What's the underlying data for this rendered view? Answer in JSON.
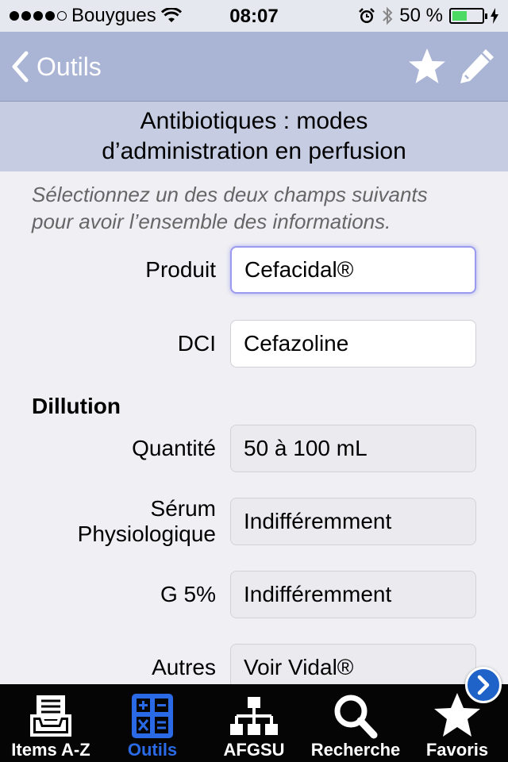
{
  "status_bar": {
    "carrier": "Bouygues",
    "time": "08:07",
    "battery_percent": "50 %",
    "battery_level": 0.5,
    "signal_bars_filled": 4,
    "signal_bars_total": 5
  },
  "nav": {
    "back_label": "Outils",
    "star_icon": "star-icon",
    "edit_icon": "pencil-icon"
  },
  "page": {
    "title": "Antibiotiques : modes\nd’administration en perfusion",
    "instructions": "Sélectionnez un des deux champs suivants\npour avoir l’ensemble des informations."
  },
  "form": {
    "produit_label": "Produit",
    "produit_value": "Cefacidal®",
    "dci_label": "DCI",
    "dci_value": "Cefazoline"
  },
  "dilution": {
    "heading": "Dillution",
    "quantite_label": "Quantité",
    "quantite_value": "50 à 100 mL",
    "serum_label": "Sérum\nPhysiologique",
    "serum_value": "Indifféremment",
    "g5_label": "G 5%",
    "g5_value": "Indifféremment",
    "autres_label": "Autres",
    "autres_value": "Voir Vidal®"
  },
  "tab_bar": {
    "tabs": [
      {
        "label": "Items A-Z",
        "icon": "inbox-icon"
      },
      {
        "label": "Outils",
        "icon": "calculator-icon"
      },
      {
        "label": "AFGSU",
        "icon": "hierarchy-icon"
      },
      {
        "label": "Recherche",
        "icon": "magnifier-icon"
      },
      {
        "label": "Favoris",
        "icon": "star-icon"
      }
    ],
    "active_index": 1
  },
  "colors": {
    "nav_bg": "#aab4d4",
    "title_bg": "#c6cde3",
    "page_bg": "#efeff4",
    "tab_active": "#2a6ae6",
    "scroll_arrow": "#1f63c8"
  }
}
